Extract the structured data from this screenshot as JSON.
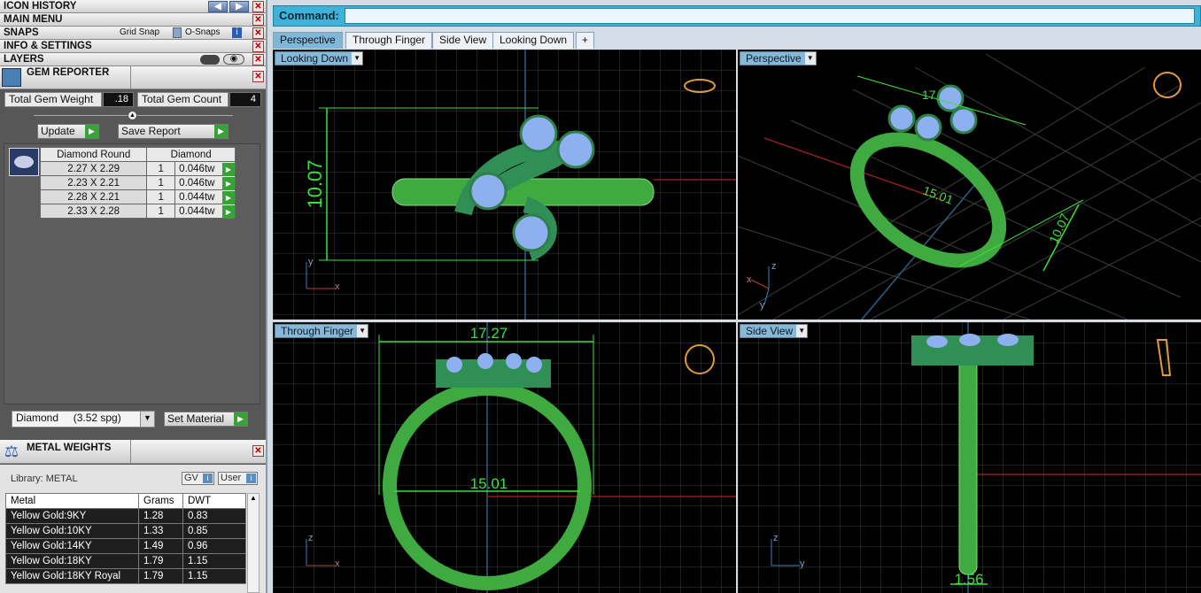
{
  "left": {
    "icon_history": "ICON HISTORY",
    "main_menu": "MAIN MENU",
    "snaps": "SNAPS",
    "grid_snap": "Grid Snap",
    "o_snaps": "O-Snaps",
    "info_settings": "INFO & SETTINGS",
    "layers": "LAYERS",
    "gem_reporter": {
      "title": "GEM REPORTER",
      "total_weight_label": "Total Gem Weight",
      "total_weight": ".18",
      "total_count_label": "Total Gem Count",
      "total_count": "4",
      "update": "Update",
      "save_report": "Save Report",
      "head": [
        "Diamond Round",
        "Diamond"
      ],
      "rows": [
        [
          "2.27 X 2.29",
          "1",
          "0.046tw"
        ],
        [
          "2.23 X 2.21",
          "1",
          "0.046tw"
        ],
        [
          "2.28 X 2.21",
          "1",
          "0.044tw"
        ],
        [
          "2.33 X 2.28",
          "1",
          "0.044tw"
        ]
      ],
      "material": "Diamond     (3.52 spg)",
      "set_material": "Set Material"
    },
    "metal_weights": {
      "title": "METAL WEIGHTS",
      "library": "Library: METAL",
      "gv": "GV",
      "user": "User",
      "cols": [
        "Metal",
        "Grams",
        "DWT"
      ],
      "rows": [
        [
          "Yellow Gold:9KY",
          "1.28",
          "0.83"
        ],
        [
          "Yellow Gold:10KY",
          "1.33",
          "0.85"
        ],
        [
          "Yellow Gold:14KY",
          "1.49",
          "0.96"
        ],
        [
          "Yellow Gold:18KY",
          "1.79",
          "1.15"
        ],
        [
          "Yellow Gold:18KY Royal",
          "1.79",
          "1.15"
        ]
      ]
    }
  },
  "command": {
    "label": "Command:",
    "value": ""
  },
  "tabs": [
    "Perspective",
    "Through Finger",
    "Side View",
    "Looking Down",
    "+"
  ],
  "viewports": {
    "looking_down": {
      "label": "Looking Down",
      "dim": "10.07",
      "axis_y": "y",
      "axis_x": "x"
    },
    "perspective": {
      "label": "Perspective",
      "dim_a": "17",
      "dim_b": "15.01",
      "dim_c": "10.07",
      "axis_z": "z",
      "axis_x": "x",
      "axis_y": "y"
    },
    "through_finger": {
      "label": "Through Finger",
      "dim_a": "17.27",
      "dim_b": "15.01",
      "axis_z": "z",
      "axis_x": "x"
    },
    "side_view": {
      "label": "Side View",
      "dim": "1.56",
      "axis_z": "z",
      "axis_y": "y"
    }
  }
}
